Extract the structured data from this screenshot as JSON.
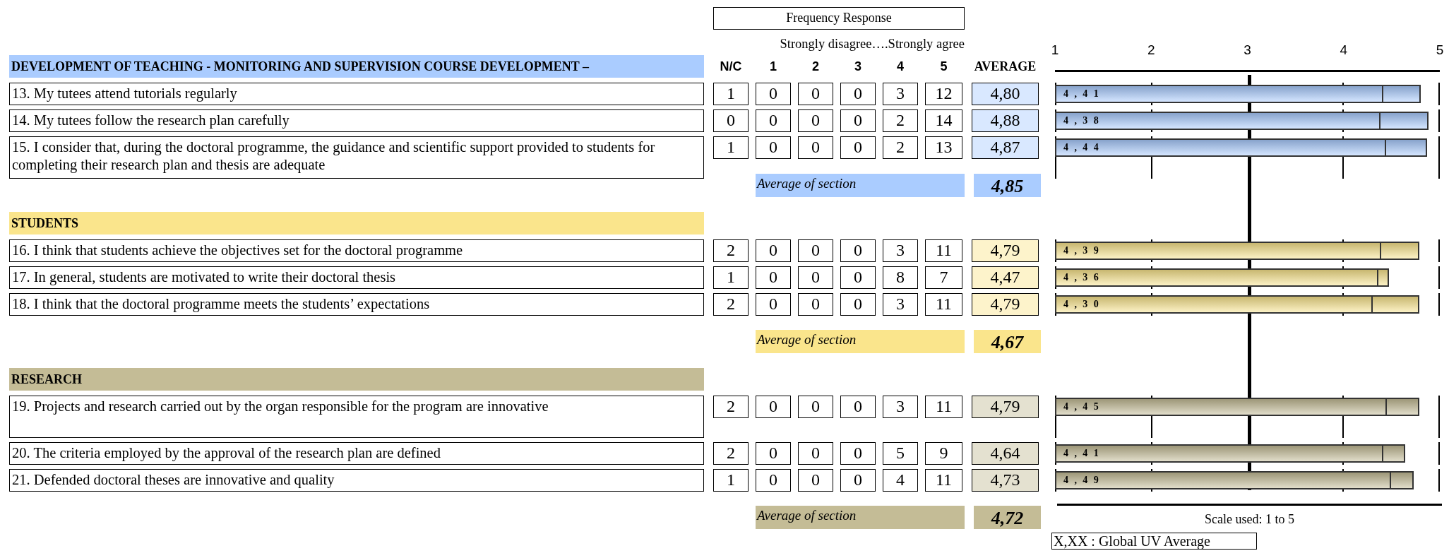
{
  "frequency_header": "Frequency Response",
  "scale_hint": "Strongly disagree….Strongly agree",
  "columns": [
    "N/C",
    "1",
    "2",
    "3",
    "4",
    "5",
    "AVERAGE"
  ],
  "chart_axis": {
    "ticks": [
      "1",
      "2",
      "3",
      "4",
      "5"
    ],
    "note": "Scale used: 1 to 5"
  },
  "sections": [
    {
      "title": "DEVELOPMENT OF TEACHING - MONITORING AND SUPERVISION COURSE DEVELOPMENT –",
      "color": "#aaccff",
      "questions": [
        {
          "text": "13. My tutees attend tutorials regularly",
          "kind": "single",
          "counts": [
            "1",
            "0",
            "0",
            "0",
            "3",
            "12"
          ],
          "average": "4,80",
          "bar": {
            "global_average": "4,41"
          }
        },
        {
          "text": "14. My tutees follow the research plan carefully",
          "kind": "single",
          "counts": [
            "0",
            "0",
            "0",
            "0",
            "2",
            "14"
          ],
          "average": "4,88",
          "bar": {
            "global_average": "4,38"
          }
        },
        {
          "text": "15. I consider that, during the doctoral programme, the guidance and scientific support provided to students for completing their research plan and thesis are adequate",
          "kind": "double",
          "counts": [
            "1",
            "0",
            "0",
            "0",
            "2",
            "13"
          ],
          "average": "4,87",
          "bar": {
            "global_average": "4,44"
          }
        }
      ],
      "average_label": "Average of section",
      "average": "4,85"
    },
    {
      "title": "STUDENTS",
      "color": "#fae58c",
      "questions": [
        {
          "text": "16. I think that students achieve the objectives set for the doctoral programme",
          "kind": "single",
          "counts": [
            "2",
            "0",
            "0",
            "0",
            "3",
            "11"
          ],
          "average": "4,79",
          "bar": {
            "global_average": "4,39"
          }
        },
        {
          "text": "17. In general, students are motivated to write their doctoral thesis",
          "kind": "single",
          "counts": [
            "1",
            "0",
            "0",
            "0",
            "8",
            "7"
          ],
          "average": "4,47",
          "bar": {
            "global_average": "4,36"
          }
        },
        {
          "text": "18. I think that the doctoral programme meets the students’ expectations",
          "kind": "single",
          "counts": [
            "2",
            "0",
            "0",
            "0",
            "3",
            "11"
          ],
          "average": "4,79",
          "bar": {
            "global_average": "4,30"
          }
        }
      ],
      "average_label": "Average of section",
      "average": "4,67"
    },
    {
      "title": "RESEARCH",
      "color": "#c4bc96",
      "questions": [
        {
          "text": "19. Projects and research carried out by the organ responsible for the program are innovative",
          "kind": "double",
          "counts": [
            "2",
            "0",
            "0",
            "0",
            "3",
            "11"
          ],
          "average": "4,79",
          "bar": {
            "global_average": "4,45"
          }
        },
        {
          "text": "20. The criteria employed by the approval of the research plan are defined",
          "kind": "single",
          "counts": [
            "2",
            "0",
            "0",
            "0",
            "5",
            "9"
          ],
          "average": "4,64",
          "bar": {
            "global_average": "4,41"
          }
        },
        {
          "text": "21. Defended doctoral theses are innovative and quality",
          "kind": "single",
          "counts": [
            "1",
            "0",
            "0",
            "0",
            "4",
            "11"
          ],
          "average": "4,73",
          "bar": {
            "global_average": "4,49"
          }
        }
      ],
      "average_label": "Average of section",
      "average": "4,72"
    }
  ],
  "legend": "X,XX : Global UV Average"
}
